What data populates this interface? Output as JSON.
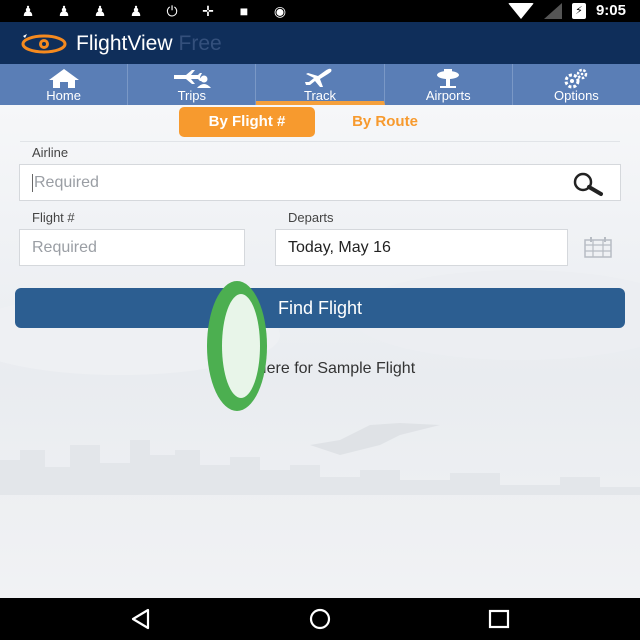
{
  "status_bar": {
    "time": "9:05",
    "battery_glyph": "⚡"
  },
  "app": {
    "name": "FlightView",
    "edition": "Free"
  },
  "nav": {
    "items": [
      {
        "label": "Home",
        "icon": "home-icon"
      },
      {
        "label": "Trips",
        "icon": "trips-icon"
      },
      {
        "label": "Track",
        "icon": "plane-icon",
        "active": true
      },
      {
        "label": "Airports",
        "icon": "airport-icon"
      },
      {
        "label": "Options",
        "icon": "gears-icon"
      }
    ]
  },
  "search_mode": {
    "by_flight": "By Flight #",
    "by_route": "By Route",
    "selected": "By Flight #"
  },
  "form": {
    "airline_label": "Airline",
    "airline_placeholder": "Required",
    "flight_label": "Flight #",
    "flight_placeholder": "Required",
    "departs_label": "Departs",
    "departs_value": "Today, May 16"
  },
  "actions": {
    "find_flight": "Find Flight",
    "sample_flight": "Tap Here for Sample Flight"
  },
  "colors": {
    "header_bg": "#0f2e5a",
    "nav_bg": "#5a7eb6",
    "accent_orange": "#f79a2e",
    "button_blue": "#2c5e91",
    "touch_indicator": "#4caf50"
  }
}
